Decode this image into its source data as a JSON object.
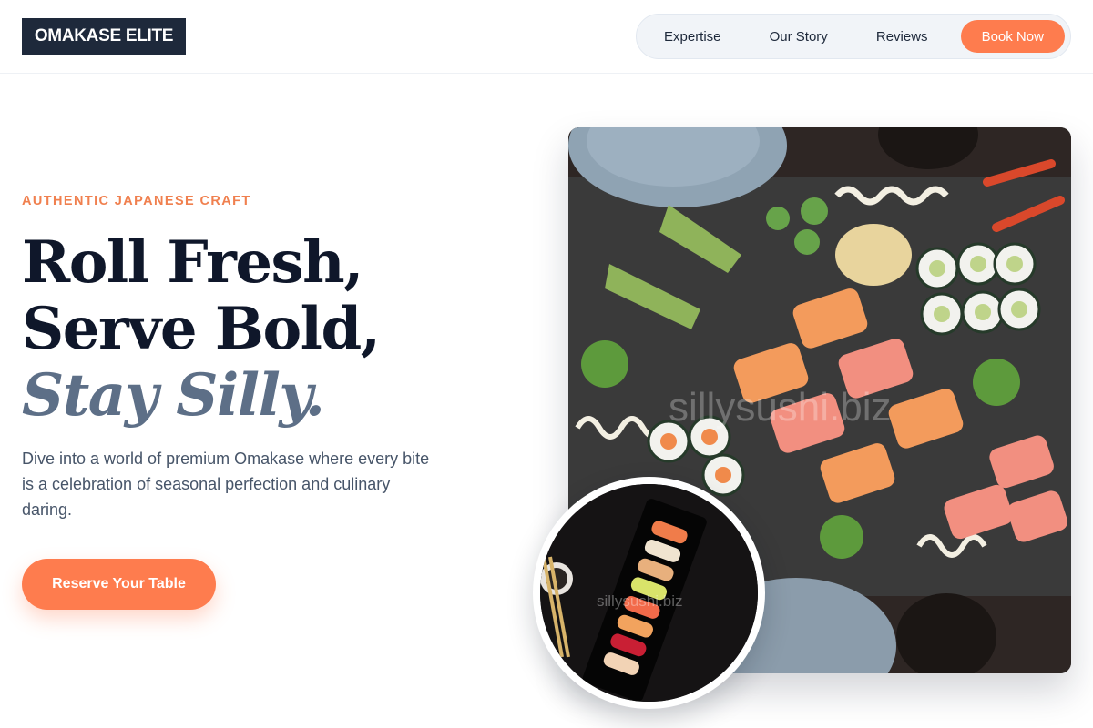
{
  "header": {
    "logo": "OMAKASE ELITE",
    "nav": [
      {
        "label": "Expertise"
      },
      {
        "label": "Our Story"
      },
      {
        "label": "Reviews"
      }
    ],
    "cta_label": "Book Now"
  },
  "hero": {
    "eyebrow": "AUTHENTIC JAPANESE CRAFT",
    "headline_line1": "Roll Fresh,",
    "headline_line2": "Serve Bold,",
    "headline_accent": "Stay Silly.",
    "lede": "Dive into a world of premium Omakase where every bite is a celebration of seasonal perfection and culinary daring.",
    "cta_label": "Reserve Your Table"
  },
  "images": {
    "main_watermark": "sillysushi.biz",
    "inset_watermark": "sillysushi.biz"
  },
  "colors": {
    "accent": "#fe7c4e",
    "navy": "#1e293b",
    "headline": "#0f172a",
    "accent_text": "#5d6f87"
  }
}
